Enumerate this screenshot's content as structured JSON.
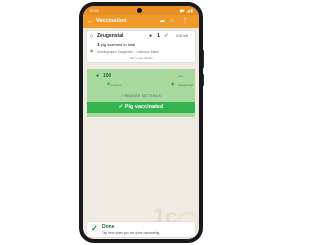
{
  "status_bar": {
    "time": "10:30",
    "battery": "◼",
    "icons": "▼ ◢ ▮"
  },
  "app_bar": {
    "title": "Vaccination",
    "back_icon": "←",
    "action_1_icon": "cloud-check-icon",
    "action_2_icon": "home-icon",
    "action_3_icon": "more-vert-icon"
  },
  "farm_card": {
    "farm_name": "Zeugenstal",
    "count": "1",
    "left_value": "216 left",
    "scanned_count": "1",
    "scanned_text": "pig scanned in total",
    "batch_left": "Arbeitsgruppe Saugferkel",
    "batch_separator": "–",
    "batch_right": "Unknown Batch",
    "tap_hint": "Tap to see details"
  },
  "scan_panel": {
    "left_value": "100",
    "left_sub": "0 scans",
    "right_label": "Use",
    "right_sub": "Zeugenstal",
    "reader_settings": "> READER SETTINGS",
    "vaccinate_button": "Pig vaccinated"
  },
  "watermark": "1c",
  "done_bar": {
    "title": "Done",
    "subtitle": "Tap here when you are done vaccinating."
  },
  "colors": {
    "status_bar": "#e88e22",
    "app_bar": "#f09a2a",
    "scan_panel": "#a7d89e",
    "vaccinate_button": "#34b24d",
    "screen_background": "#efeae2"
  }
}
